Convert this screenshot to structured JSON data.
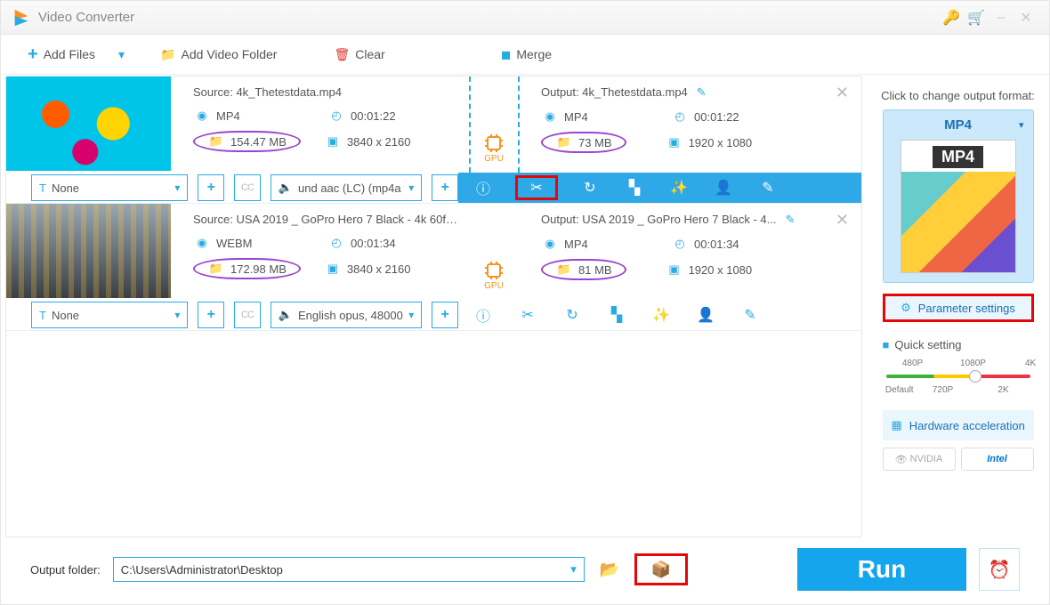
{
  "app": {
    "title": "Video Converter"
  },
  "toolbar": {
    "add_files": "Add Files",
    "add_folder": "Add Video Folder",
    "clear": "Clear",
    "merge": "Merge"
  },
  "items": [
    {
      "source_label": "Source:",
      "source_name": "4k_Thetestdata.mp4",
      "src_format": "MP4",
      "src_duration": "00:01:22",
      "src_size": "154.47 MB",
      "src_res": "3840 x 2160",
      "output_label": "Output:",
      "output_name": "4k_Thetestdata.mp4",
      "out_format": "MP4",
      "out_duration": "00:01:22",
      "out_size": "73 MB",
      "out_res": "1920 x 1080",
      "gpu_label": "GPU",
      "subtitle_sel": "None",
      "audio_sel": "und aac (LC) (mp4a"
    },
    {
      "source_label": "Source:",
      "source_name": "USA 2019 _ GoPro Hero 7 Black - 4k 60fp...",
      "src_format": "WEBM",
      "src_duration": "00:01:34",
      "src_size": "172.98 MB",
      "src_res": "3840 x 2160",
      "output_label": "Output:",
      "output_name": "USA 2019 _ GoPro Hero 7 Black - 4...",
      "out_format": "MP4",
      "out_duration": "00:01:34",
      "out_size": "81 MB",
      "out_res": "1920 x 1080",
      "gpu_label": "GPU",
      "subtitle_sel": "None",
      "audio_sel": "English opus, 48000"
    }
  ],
  "side": {
    "heading": "Click to change output format:",
    "format": "MP4",
    "format_label": "MP4",
    "param_settings": "Parameter settings",
    "quick_setting": "Quick setting",
    "ticks": {
      "p480": "480P",
      "p1080": "1080P",
      "p4k": "4K",
      "def": "Default",
      "p720": "720P",
      "p2k": "2K"
    },
    "hwaccel": "Hardware acceleration",
    "nvidia": "NVIDIA",
    "intel": "Intel"
  },
  "bottom": {
    "out_folder_label": "Output folder:",
    "path": "C:\\Users\\Administrator\\Desktop",
    "run": "Run"
  }
}
